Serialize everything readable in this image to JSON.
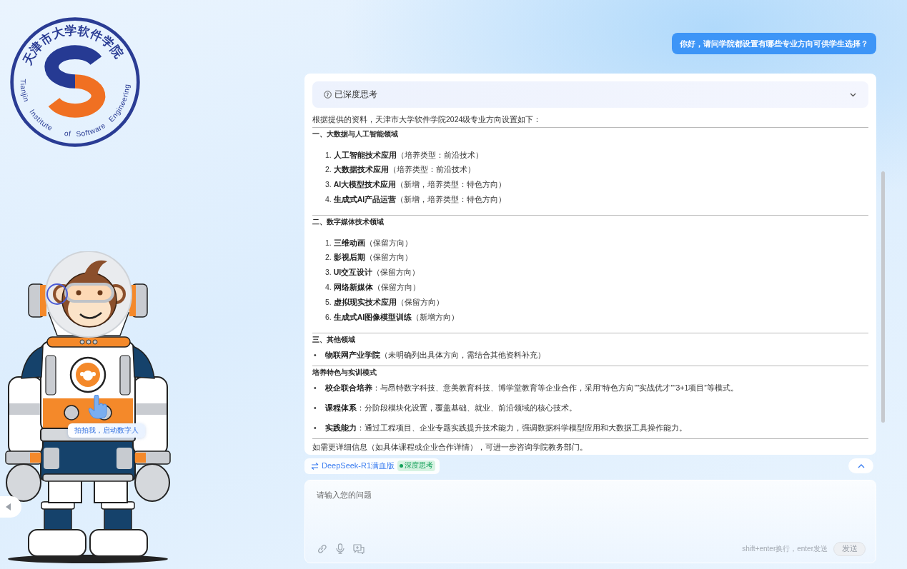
{
  "sidebar": {
    "logo": {
      "name_zh": "天津市大学软件学院",
      "name_en": "Tianjin Institute of Software Engineering"
    },
    "mascot": {
      "tooltip": "拍拍我，启动数字人"
    }
  },
  "conversation": {
    "user_message": "你好，请问学院都设置有哪些专业方向可供学生选择？",
    "answer": {
      "thinking": {
        "label": "已深度思考",
        "expanded": false
      },
      "blocks": [
        {
          "kind": "paragraph",
          "text": "根据提供的资料，天津市大学软件学院2024级专业方向设置如下："
        },
        {
          "kind": "rule"
        },
        {
          "kind": "heading",
          "text": "一、大数据与人工智能领域"
        },
        {
          "kind": "ordered_list",
          "items": [
            {
              "marker": "1.",
              "text": "**人工智能技术应用**（培养类型：前沿技术）"
            },
            {
              "marker": "2.",
              "text": "**大数据技术应用**（培养类型：前沿技术）"
            },
            {
              "marker": "3.",
              "text": "**AI大模型技术应用**（新增，培养类型：特色方向）"
            },
            {
              "marker": "4.",
              "text": "**生成式AI产品运营**（新增，培养类型：特色方向）"
            }
          ]
        },
        {
          "kind": "rule"
        },
        {
          "kind": "heading",
          "text": "二、数字媒体技术领域"
        },
        {
          "kind": "ordered_list",
          "items": [
            {
              "marker": "1.",
              "text": "**三维动画**（保留方向）"
            },
            {
              "marker": "2.",
              "text": "**影视后期**（保留方向）"
            },
            {
              "marker": "3.",
              "text": "**UI交互设计**（保留方向）"
            },
            {
              "marker": "4.",
              "text": "**网络新媒体**（保留方向）"
            },
            {
              "marker": "5.",
              "text": "**虚拟现实技术应用**（保留方向）"
            },
            {
              "marker": "6.",
              "text": "**生成式AI图像模型训练**（新增方向）"
            }
          ]
        },
        {
          "kind": "rule"
        },
        {
          "kind": "heading",
          "text": "三、其他领域"
        },
        {
          "kind": "bullet_list",
          "items": [
            {
              "marker": "•",
              "text": "**物联网产业学院**（未明确列出具体方向，需结合其他资料补充）"
            }
          ]
        },
        {
          "kind": "rule"
        },
        {
          "kind": "heading",
          "text": "培养特色与实训模式"
        },
        {
          "kind": "bullet_list",
          "items": [
            {
              "marker": "•",
              "text": "**校企联合培养**：与昂特数字科技、意美教育科技、博学堂教育等企业合作，采用“特色方向”“实战优才”“3+1项目”等模式。"
            },
            {
              "marker": "•",
              "text": "**课程体系**：分阶段模块化设置，覆盖基础、就业、前沿领域的核心技术。"
            },
            {
              "marker": "•",
              "text": "**实践能力**：通过工程项目、企业专题实践提升技术能力，强调数据科学模型应用和大数据工具操作能力。"
            }
          ]
        },
        {
          "kind": "rule"
        },
        {
          "kind": "paragraph",
          "text": "如需更详细信息（如具体课程或企业合作详情），可进一步咨询学院教务部门。"
        }
      ]
    }
  },
  "model_bar": {
    "model": "DeepSeek-R1满血版",
    "mode_tag": {
      "label": "深度思考",
      "on": true
    }
  },
  "composer": {
    "placeholder": "请输入您的问题",
    "hint": "shift+enter换行，enter发送",
    "send_label": "发送",
    "send_disabled": true
  }
}
